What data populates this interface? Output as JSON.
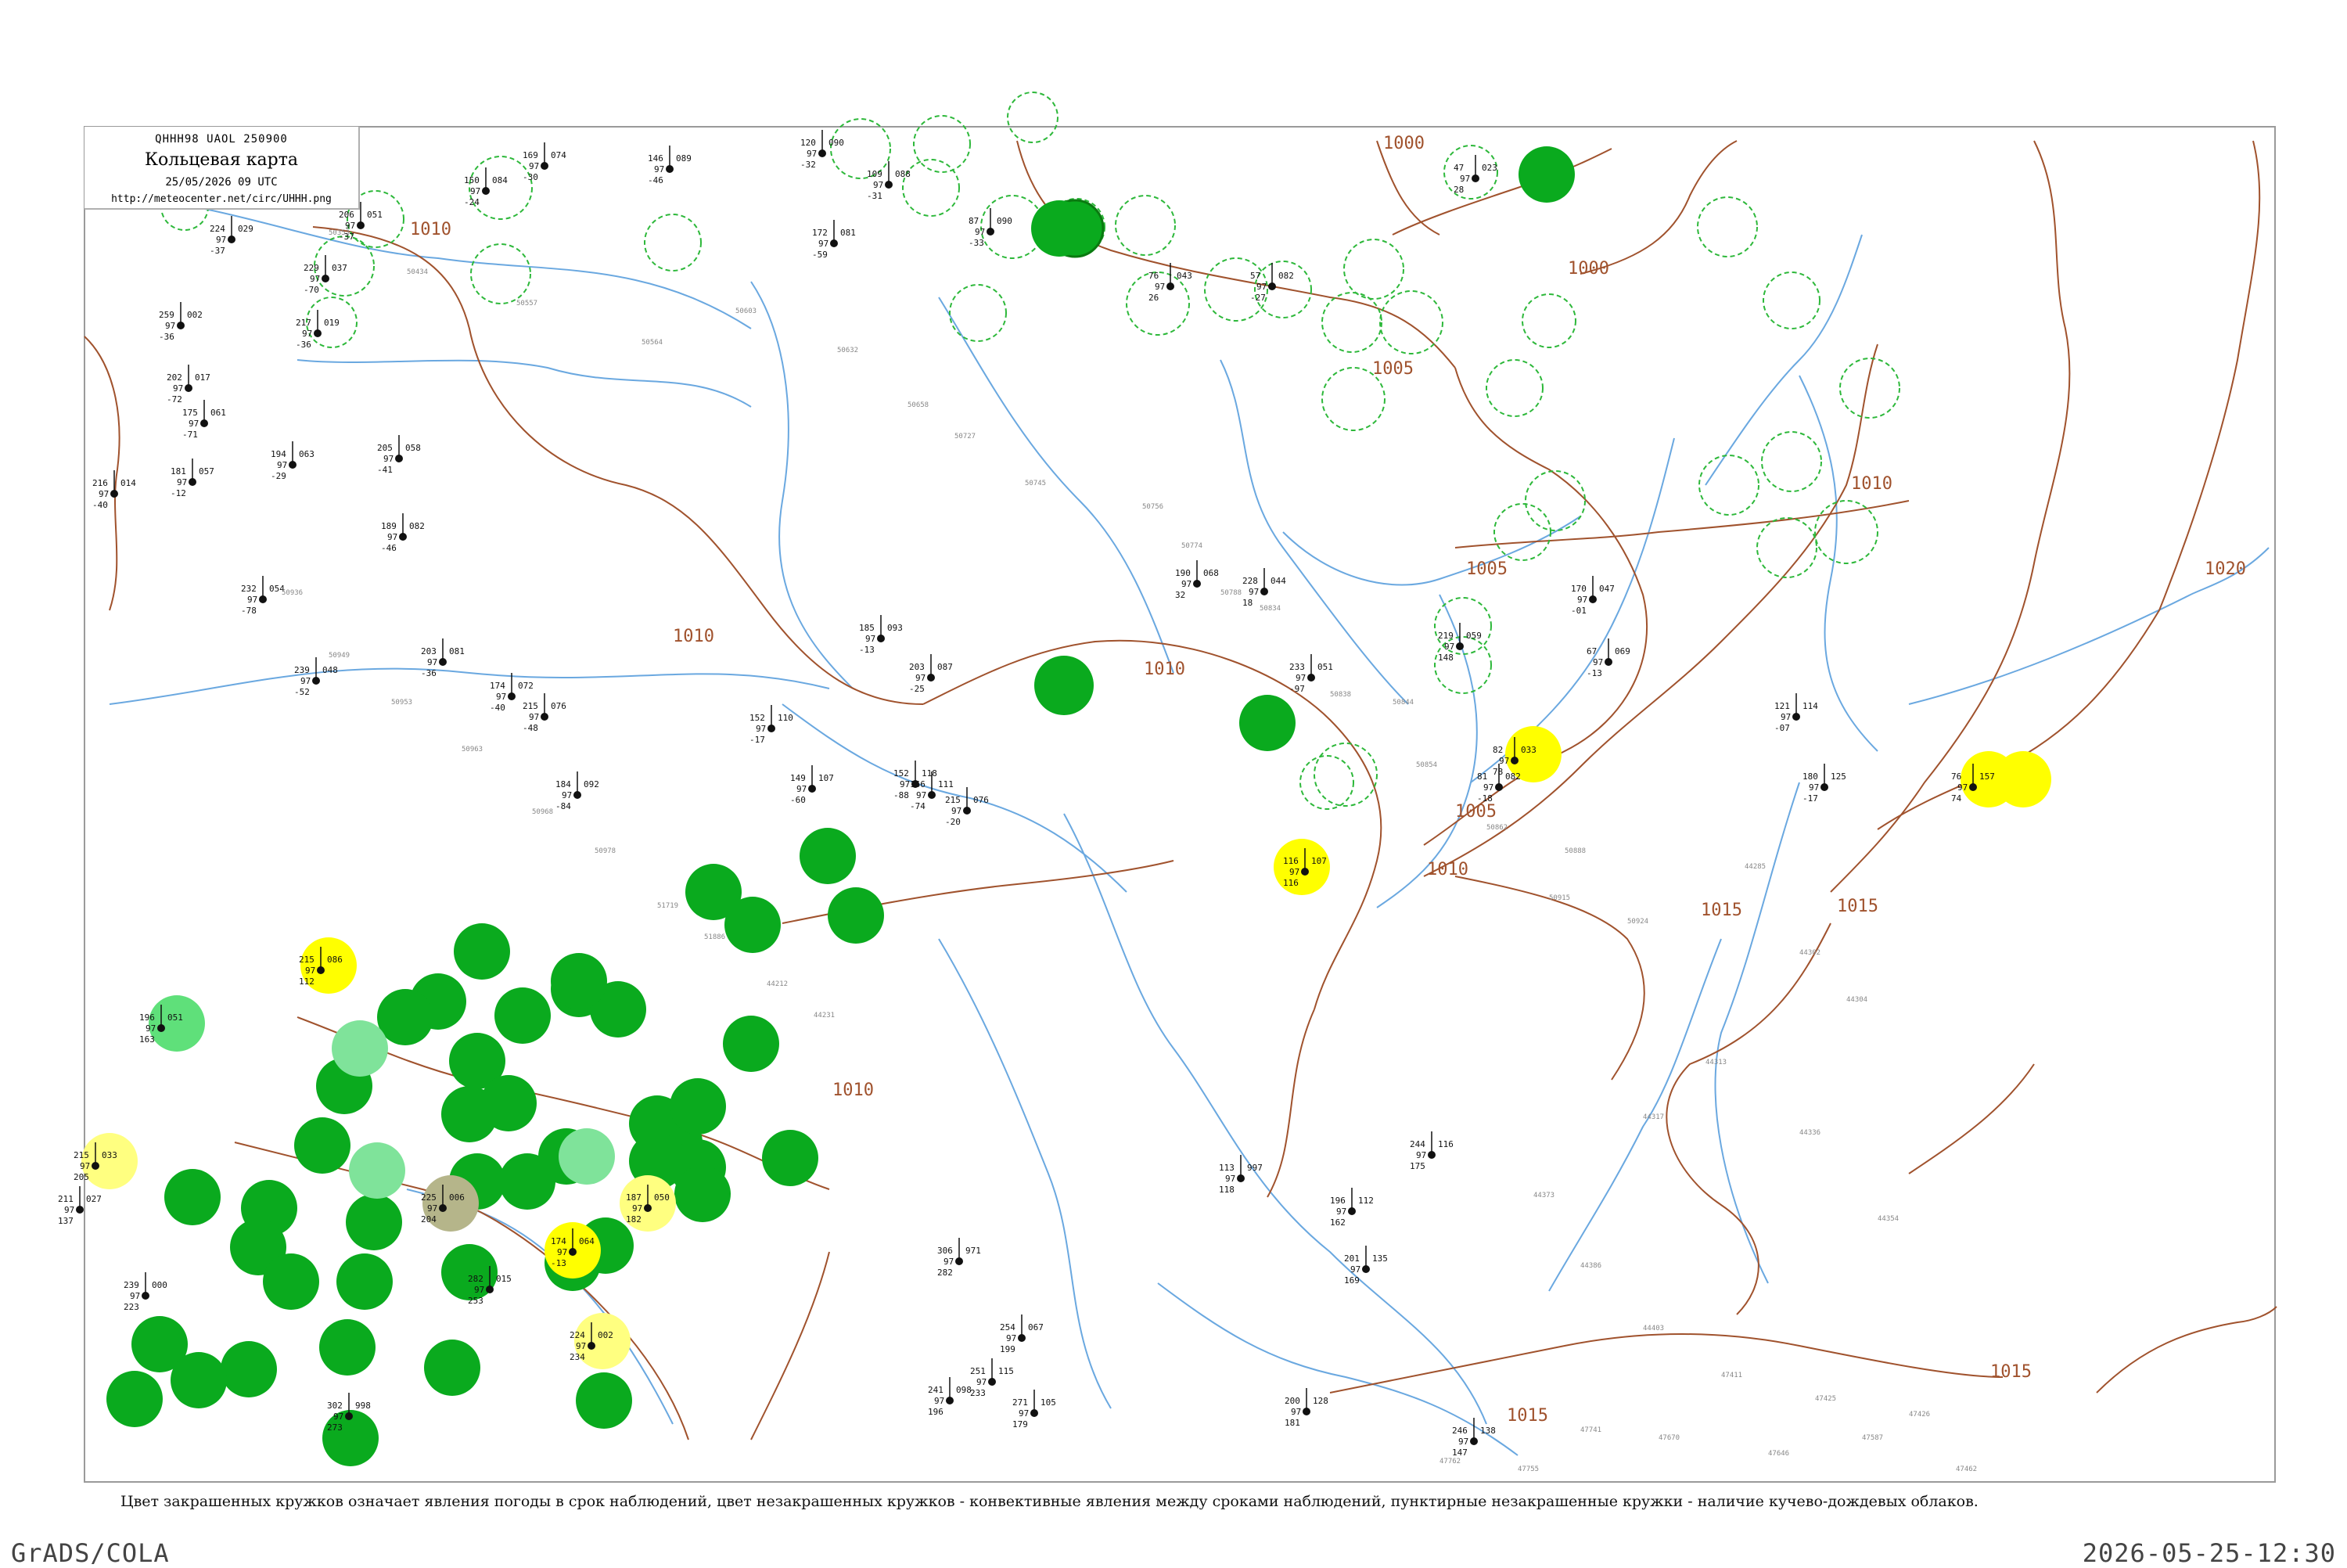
{
  "header": {
    "bulletin": "QHHH98  UAOL  250900",
    "title": "Кольцевая карта",
    "datetime": "25/05/2026 09 UTC",
    "url": "http://meteocenter.net/circ/UHHH.png"
  },
  "isobar_labels": [
    "1000",
    "1005",
    "1010",
    "1015",
    "1020",
    "1010",
    "1005",
    "1010",
    "1010",
    "1000",
    "1015",
    "1010",
    "1015",
    "1005",
    "1010",
    "1000",
    "1015"
  ],
  "legend_note": "Цвет закрашенных кружков означает явления погоды в срок наблюдений, цвет незакрашенных кружков - конвективные явления между сроками наблюдений, пунктирные незакрашенные кружки - наличие кучево-дождевых облаков.",
  "footer": {
    "left": "GrADS/COLA",
    "right": "2026-05-25-12:30"
  },
  "colors": {
    "map_border": "#9a9a9a",
    "river": "#6aa8e0",
    "isobar": "#a0522d",
    "rain_fill": "#0aaa1e",
    "rain_light_fill": "#5fe07a",
    "fog_fill": "#ffff00",
    "haze_fill": "#ffff80",
    "dust_fill": "#b5b58a",
    "cb_dashed": "#2db83a"
  },
  "stations": [
    {
      "t": "150",
      "p": "084",
      "d": "-24"
    },
    {
      "t": "169",
      "p": "074",
      "d": "-30"
    },
    {
      "t": "146",
      "p": "089",
      "d": "-46"
    },
    {
      "t": "120",
      "p": "090",
      "d": "-32"
    },
    {
      "t": "109",
      "p": "088",
      "d": "-31"
    },
    {
      "t": "87",
      "p": "090",
      "d": "-33"
    },
    {
      "t": "57",
      "p": "082",
      "d": "-27"
    },
    {
      "t": "76",
      "p": "043",
      "d": "26"
    },
    {
      "t": "47",
      "p": "023",
      "d": "28"
    },
    {
      "t": "206",
      "p": "051",
      "d": "-37"
    },
    {
      "t": "224",
      "p": "029",
      "d": "-37"
    },
    {
      "t": "229",
      "p": "037",
      "d": "-70"
    },
    {
      "t": "217",
      "p": "019",
      "d": "-36"
    },
    {
      "t": "259",
      "p": "002",
      "d": "-36"
    },
    {
      "t": "202",
      "p": "017",
      "d": "-72"
    },
    {
      "t": "175",
      "p": "061",
      "d": "-71"
    },
    {
      "t": "216",
      "p": "014",
      "d": "-40"
    },
    {
      "t": "181",
      "p": "057",
      "d": "-12"
    },
    {
      "t": "194",
      "p": "063",
      "d": "-29"
    },
    {
      "t": "205",
      "p": "058",
      "d": "-41"
    },
    {
      "t": "189",
      "p": "082",
      "d": "-46"
    },
    {
      "t": "232",
      "p": "054",
      "d": "-78"
    },
    {
      "t": "239",
      "p": "048",
      "d": "-52"
    },
    {
      "t": "203",
      "p": "081",
      "d": "-36"
    },
    {
      "t": "174",
      "p": "072",
      "d": "-40"
    },
    {
      "t": "215",
      "p": "076",
      "d": "-48"
    },
    {
      "t": "184",
      "p": "092",
      "d": "-84"
    },
    {
      "t": "152",
      "p": "110",
      "d": "-17"
    },
    {
      "t": "172",
      "p": "081",
      "d": "-59"
    },
    {
      "t": "185",
      "p": "093",
      "d": "-13"
    },
    {
      "t": "203",
      "p": "087",
      "d": "-25"
    },
    {
      "t": "215",
      "p": "076",
      "d": "-20"
    },
    {
      "t": "166",
      "p": "111",
      "d": "-74"
    },
    {
      "t": "149",
      "p": "107",
      "d": "-60"
    },
    {
      "t": "152",
      "p": "118",
      "d": "-88"
    },
    {
      "t": "190",
      "p": "068",
      "d": "32"
    },
    {
      "t": "228",
      "p": "044",
      "d": "18"
    },
    {
      "t": "233",
      "p": "051",
      "d": "-97"
    },
    {
      "t": "219",
      "p": "059",
      "d": "148"
    },
    {
      "t": "170",
      "p": "047",
      "d": "-01"
    },
    {
      "t": "67",
      "p": "069",
      "d": "-13"
    },
    {
      "t": "82",
      "p": "033",
      "d": "78"
    },
    {
      "t": "81",
      "p": "082",
      "d": "-18"
    },
    {
      "t": "180",
      "p": "125",
      "d": "-17"
    },
    {
      "t": "121",
      "p": "114",
      "d": "-07"
    },
    {
      "t": "76",
      "p": "157",
      "d": "74"
    },
    {
      "t": "215",
      "p": "033",
      "d": "205"
    },
    {
      "t": "174",
      "p": "064",
      "d": "-13"
    },
    {
      "t": "187",
      "p": "050",
      "d": "182"
    },
    {
      "t": "225",
      "p": "006",
      "d": "204"
    },
    {
      "t": "224",
      "p": "002",
      "d": "234"
    },
    {
      "t": "116",
      "p": "107",
      "d": "116"
    },
    {
      "t": "215",
      "p": "086",
      "d": "112"
    },
    {
      "t": "196",
      "p": "051",
      "d": "163"
    },
    {
      "t": "211",
      "p": "027",
      "d": "137"
    },
    {
      "t": "239",
      "p": "000",
      "d": "223"
    },
    {
      "t": "282",
      "p": "015",
      "d": "253"
    },
    {
      "t": "302",
      "p": "998",
      "d": "273"
    },
    {
      "t": "306",
      "p": "971",
      "d": "282"
    },
    {
      "t": "251",
      "p": "115",
      "d": "233"
    },
    {
      "t": "254",
      "p": "067",
      "d": "199"
    },
    {
      "t": "241",
      "p": "098",
      "d": "196"
    },
    {
      "t": "271",
      "p": "105",
      "d": "179"
    },
    {
      "t": "200",
      "p": "128",
      "d": "181"
    },
    {
      "t": "246",
      "p": "138",
      "d": "147"
    },
    {
      "t": "244",
      "p": "116",
      "d": "175"
    },
    {
      "t": "196",
      "p": "112",
      "d": "162"
    },
    {
      "t": "201",
      "p": "135",
      "d": "169"
    },
    {
      "t": "113",
      "p": "997",
      "d": "118"
    }
  ],
  "station_ids": [
    "50353",
    "50434",
    "50557",
    "50564",
    "50603",
    "50632",
    "50658",
    "50727",
    "50745",
    "50756",
    "50774",
    "50788",
    "50834",
    "50838",
    "50844",
    "50854",
    "50862",
    "50888",
    "50915",
    "50924",
    "50936",
    "50949",
    "50953",
    "50963",
    "50968",
    "50978",
    "51719",
    "51886",
    "44212",
    "44231",
    "44285",
    "44302",
    "44304",
    "44313",
    "44317",
    "44336",
    "44354",
    "44373",
    "44386",
    "44403",
    "47411",
    "47425",
    "47426",
    "47462",
    "47587",
    "47646",
    "47670",
    "47741",
    "47755",
    "47762"
  ]
}
